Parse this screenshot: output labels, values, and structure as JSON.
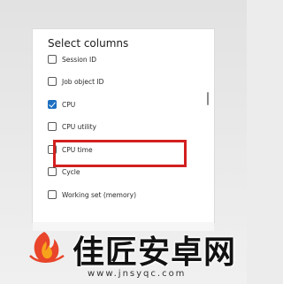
{
  "dialog": {
    "title": "Select columns",
    "items": [
      {
        "label": "Session ID",
        "checked": false
      },
      {
        "label": "Job object ID",
        "checked": false
      },
      {
        "label": "CPU",
        "checked": true
      },
      {
        "label": "CPU utility",
        "checked": false
      },
      {
        "label": "CPU time",
        "checked": false
      },
      {
        "label": "Cycle",
        "checked": false
      },
      {
        "label": "Working set (memory)",
        "checked": false
      }
    ]
  },
  "colors": {
    "accent": "#1d6fc2",
    "highlight": "#d21f1f"
  },
  "watermark": {
    "text": "佳匠安卓网",
    "url": "www.jnsyqc.com"
  }
}
